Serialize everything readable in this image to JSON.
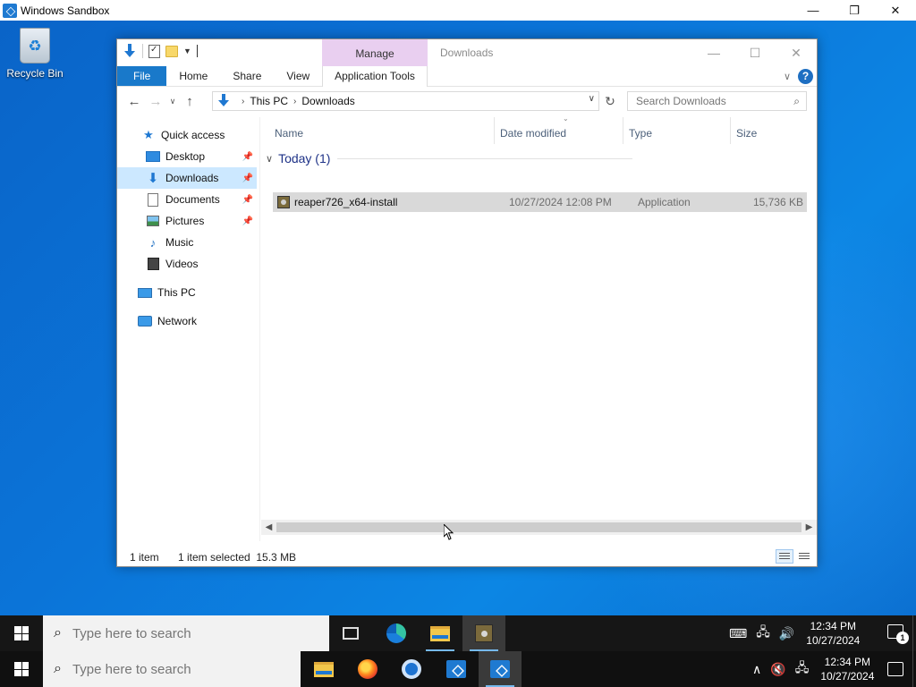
{
  "host": {
    "title": "Windows Sandbox",
    "controls": {
      "minimize": "—",
      "maximize": "❐",
      "close": "✕"
    }
  },
  "desktop": {
    "icons": [
      {
        "label": "Recycle Bin",
        "icon": "recycle-bin-icon"
      }
    ]
  },
  "explorer": {
    "title": "Downloads",
    "contextual_tab": "Manage",
    "ribbon_tabs": [
      "File",
      "Home",
      "Share",
      "View",
      "Application Tools"
    ],
    "breadcrumb": [
      "This PC",
      "Downloads"
    ],
    "search_placeholder": "Search Downloads",
    "nav_pane": [
      {
        "label": "Quick access",
        "icon": "star-icon"
      },
      {
        "label": "Desktop",
        "icon": "desktop-folder-icon",
        "pinned": true
      },
      {
        "label": "Downloads",
        "icon": "downloads-folder-icon",
        "pinned": true,
        "selected": true
      },
      {
        "label": "Documents",
        "icon": "documents-folder-icon",
        "pinned": true
      },
      {
        "label": "Pictures",
        "icon": "pictures-folder-icon",
        "pinned": true
      },
      {
        "label": "Music",
        "icon": "music-folder-icon"
      },
      {
        "label": "Videos",
        "icon": "videos-folder-icon"
      },
      {
        "label": "This PC",
        "icon": "computer-icon"
      },
      {
        "label": "Network",
        "icon": "network-icon"
      }
    ],
    "columns": [
      "Name",
      "Date modified",
      "Type",
      "Size"
    ],
    "group": "Today (1)",
    "files": [
      {
        "name": "reaper726_x64-install",
        "date": "10/27/2024 12:08 PM",
        "type": "Application",
        "size": "15,736 KB",
        "selected": true
      }
    ],
    "status": {
      "count": "1 item",
      "selection": "1 item selected  15.3 MB"
    }
  },
  "taskbar_top": {
    "search_placeholder": "Type here to search",
    "apps": [
      "task-view",
      "edge",
      "file-explorer",
      "reaper-installer"
    ],
    "clock": {
      "time": "12:34 PM",
      "date": "10/27/2024"
    },
    "notification_count": "1"
  },
  "taskbar_bottom": {
    "search_placeholder": "Type here to search",
    "apps": [
      "file-explorer",
      "firefox",
      "chrome",
      "windows-sandbox",
      "windows-sandbox-active"
    ],
    "clock": {
      "time": "12:34 PM",
      "date": "10/27/2024"
    }
  },
  "colors": {
    "desktop_blue": "#0b74d8",
    "file_tab_blue": "#1979ca",
    "manage_tab_pink": "#e9cff0",
    "selection_blue": "#cce8ff",
    "selected_row_gray": "#d9d9d9"
  }
}
